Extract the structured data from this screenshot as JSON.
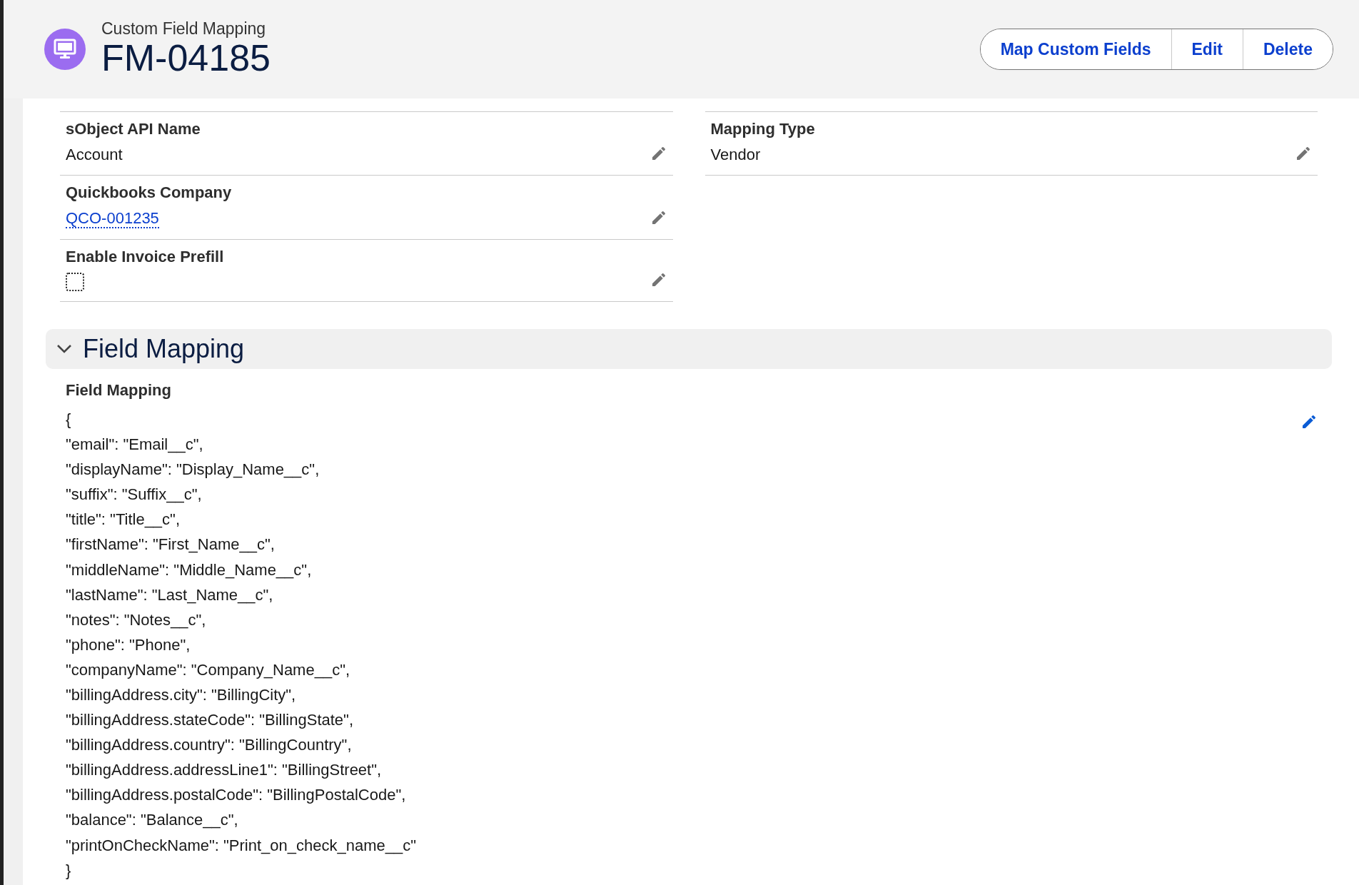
{
  "header": {
    "object_type": "Custom Field Mapping",
    "title": "FM-04185",
    "buttons": [
      "Map Custom Fields",
      "Edit",
      "Delete"
    ]
  },
  "fields": {
    "left": [
      {
        "label": "sObject API Name",
        "kind": "text",
        "value": "Account"
      },
      {
        "label": "Quickbooks Company",
        "kind": "link",
        "value": "QCO-001235"
      },
      {
        "label": "Enable Invoice Prefill",
        "kind": "checkbox",
        "checked": false
      }
    ],
    "right": [
      {
        "label": "Mapping Type",
        "kind": "text",
        "value": "Vendor"
      }
    ]
  },
  "section": {
    "title": "Field Mapping",
    "expanded": true,
    "field": {
      "label": "Field Mapping",
      "lines": [
        "{",
        "\"email\": \"Email__c\",",
        "\"displayName\": \"Display_Name__c\",",
        "\"suffix\": \"Suffix__c\",",
        "\"title\": \"Title__c\",",
        "\"firstName\": \"First_Name__c\",",
        "\"middleName\": \"Middle_Name__c\",",
        "\"lastName\": \"Last_Name__c\",",
        "\"notes\": \"Notes__c\",",
        "\"phone\": \"Phone\",",
        "\"companyName\": \"Company_Name__c\",",
        "\"billingAddress.city\": \"BillingCity\",",
        "\"billingAddress.stateCode\": \"BillingState\",",
        "\"billingAddress.country\": \"BillingCountry\",",
        "\"billingAddress.addressLine1\": \"BillingStreet\",",
        "\"billingAddress.postalCode\": \"BillingPostalCode\",",
        "\"balance\": \"Balance__c\",",
        "\"printOnCheckName\": \"Print_on_check_name__c\"",
        "}"
      ]
    }
  }
}
